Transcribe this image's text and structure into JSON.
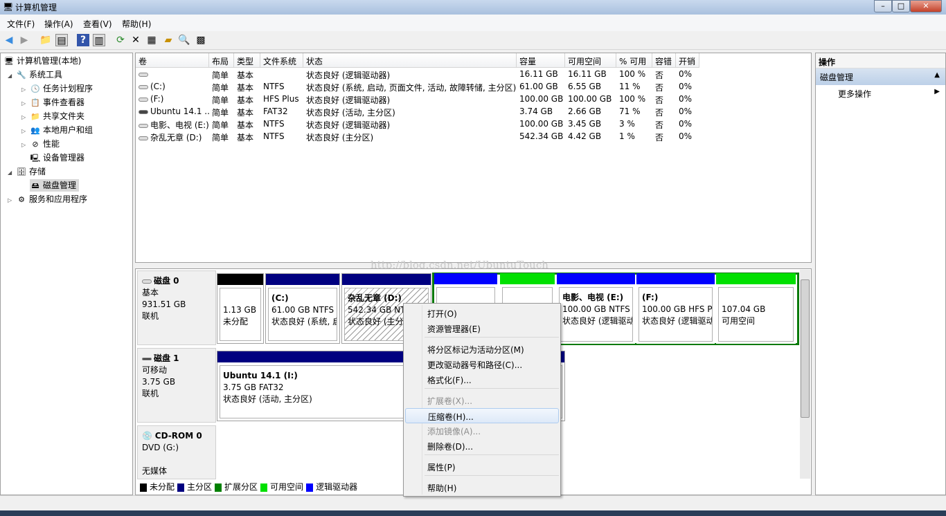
{
  "window": {
    "title": "计算机管理",
    "min": "–",
    "max": "□",
    "close": "✕"
  },
  "menu": [
    "文件(F)",
    "操作(A)",
    "查看(V)",
    "帮助(H)"
  ],
  "toolbar": [
    "back-icon",
    "forward-icon",
    "up-icon",
    "show-hide-tree-icon",
    "help-icon",
    "show-hide-action-icon",
    "refresh-icon",
    "delete-icon",
    "properties-icon",
    "open-icon",
    "search-icon",
    "settings-icon"
  ],
  "tree": {
    "root": "计算机管理(本地)",
    "items": [
      {
        "label": "系统工具",
        "level": 1,
        "expanded": true
      },
      {
        "label": "任务计划程序",
        "level": 2
      },
      {
        "label": "事件查看器",
        "level": 2
      },
      {
        "label": "共享文件夹",
        "level": 2
      },
      {
        "label": "本地用户和组",
        "level": 2
      },
      {
        "label": "性能",
        "level": 2
      },
      {
        "label": "设备管理器",
        "level": 2
      },
      {
        "label": "存储",
        "level": 1,
        "expanded": true
      },
      {
        "label": "磁盘管理",
        "level": 2,
        "selected": true
      },
      {
        "label": "服务和应用程序",
        "level": 1
      }
    ]
  },
  "table": {
    "headers": [
      "卷",
      "布局",
      "类型",
      "文件系统",
      "状态",
      "容量",
      "可用空间",
      "% 可用",
      "容错",
      "开销"
    ],
    "rows": [
      [
        "",
        "简单",
        "基本",
        "",
        "状态良好 (逻辑驱动器)",
        "16.11 GB",
        "16.11 GB",
        "100 %",
        "否",
        "0%"
      ],
      [
        "(C:)",
        "简单",
        "基本",
        "NTFS",
        "状态良好 (系统, 启动, 页面文件, 活动, 故障转储, 主分区)",
        "61.00 GB",
        "6.55 GB",
        "11 %",
        "否",
        "0%"
      ],
      [
        "(F:)",
        "简单",
        "基本",
        "HFS Plus",
        "状态良好 (逻辑驱动器)",
        "100.00 GB",
        "100.00 GB",
        "100 %",
        "否",
        "0%"
      ],
      [
        "Ubuntu 14.1 ...",
        "简单",
        "基本",
        "FAT32",
        "状态良好 (活动, 主分区)",
        "3.74 GB",
        "2.66 GB",
        "71 %",
        "否",
        "0%"
      ],
      [
        "电影、电视 (E:)",
        "简单",
        "基本",
        "NTFS",
        "状态良好 (逻辑驱动器)",
        "100.00 GB",
        "3.45 GB",
        "3 %",
        "否",
        "0%"
      ],
      [
        "杂乱无章 (D:)",
        "简单",
        "基本",
        "NTFS",
        "状态良好 (主分区)",
        "542.34 GB",
        "4.42 GB",
        "1 %",
        "否",
        "0%"
      ]
    ]
  },
  "watermark": "http://blog.csdn.net/UbuntuTouch",
  "disks": [
    {
      "name": "磁盘 0",
      "type": "基本",
      "size": "931.51 GB",
      "state": "联机"
    },
    {
      "name": "磁盘 1",
      "type": "可移动",
      "size": "3.75 GB",
      "state": "联机"
    },
    {
      "name": "CD-ROM 0",
      "type": "DVD (G:)",
      "state": "无媒体"
    }
  ],
  "partitions0": [
    {
      "title": "",
      "l1": "1.13 GB",
      "l2": "未分配"
    },
    {
      "title": "(C:)",
      "l1": "61.00 GB NTFS",
      "l2": "状态良好 (系统, 启"
    },
    {
      "title": "杂乱无章  (D:)",
      "l1": "542.34 GB NTFS",
      "l2": "状态良好 (主分"
    },
    {
      "title": "电影、电视  (E:)",
      "l1": "100.00 GB NTFS",
      "l2": "状态良好 (逻辑驱动"
    },
    {
      "title": "(F:)",
      "l1": "100.00 GB HFS Pl",
      "l2": "状态良好 (逻辑驱动"
    },
    {
      "title": "",
      "l1": "107.04 GB",
      "l2": "可用空间"
    }
  ],
  "partition1": {
    "title": "Ubuntu 14.1  (I:)",
    "l1": "3.75 GB FAT32",
    "l2": "状态良好 (活动, 主分区)"
  },
  "legend": [
    {
      "label": "未分配",
      "color": "#000000"
    },
    {
      "label": "主分区",
      "color": "#000080"
    },
    {
      "label": "扩展分区",
      "color": "#008000"
    },
    {
      "label": "可用空间",
      "color": "#00e000"
    },
    {
      "label": "逻辑驱动器",
      "color": "#0000ff"
    }
  ],
  "actions": {
    "header": "操作",
    "section": "磁盘管理",
    "more": "更多操作"
  },
  "context_menu": [
    {
      "label": "打开(O)"
    },
    {
      "label": "资源管理器(E)"
    },
    {
      "label": "将分区标记为活动分区(M)"
    },
    {
      "label": "更改驱动器号和路径(C)..."
    },
    {
      "label": "格式化(F)..."
    },
    {
      "label": "扩展卷(X)...",
      "disabled": true
    },
    {
      "label": "压缩卷(H)...",
      "highlighted": true
    },
    {
      "label": "添加镜像(A)...",
      "disabled": true
    },
    {
      "label": "删除卷(D)..."
    },
    {
      "label": "属性(P)"
    },
    {
      "label": "帮助(H)"
    }
  ]
}
